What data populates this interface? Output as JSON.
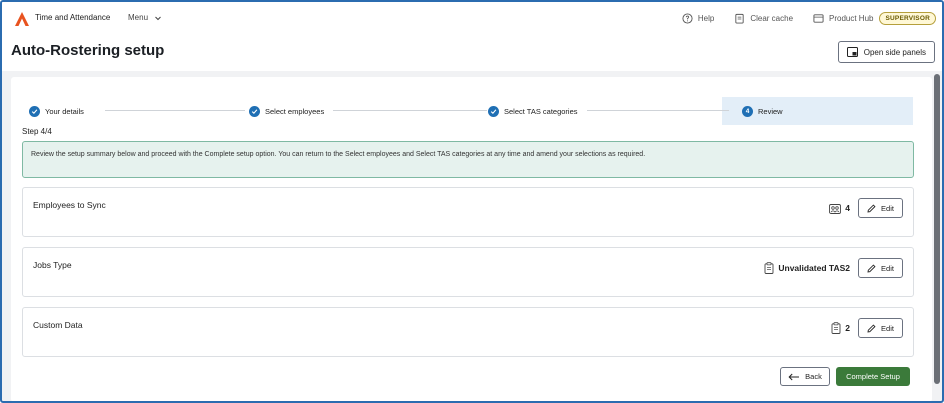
{
  "app": {
    "title": "Time and Attendance",
    "menu_label": "Menu"
  },
  "topbar": {
    "help_label": "Help",
    "clear_cache_label": "Clear cache",
    "product_hub_label": "Product Hub",
    "role_badge": "SUPERVISOR"
  },
  "page": {
    "title": "Auto-Rostering setup",
    "side_panels_label": "Open side panels"
  },
  "stepper": {
    "steps": [
      {
        "label": "Your details",
        "state": "complete"
      },
      {
        "label": "Select employees",
        "state": "complete"
      },
      {
        "label": "Select TAS categories",
        "state": "complete"
      },
      {
        "label": "Review",
        "state": "active",
        "number": "4"
      }
    ],
    "step_count": "Step 4/4"
  },
  "info_message": "Review the setup summary below and proceed with the Complete setup option. You can return to the Select employees and Select TAS categories at any time and amend your selections as required.",
  "sections": [
    {
      "title": "Employees to Sync",
      "value": "4",
      "icon": "employees-icon",
      "edit_label": "Edit"
    },
    {
      "title": "Jobs Type",
      "value": "Unvalidated TAS2",
      "icon": "clipboard-icon",
      "edit_label": "Edit"
    },
    {
      "title": "Custom Data",
      "value": "2",
      "icon": "clipboard-icon",
      "edit_label": "Edit"
    }
  ],
  "actions": {
    "back_label": "Back",
    "complete_label": "Complete Setup"
  },
  "colors": {
    "accent": "#1f6fb4",
    "primary_button": "#3b7a3a",
    "info_bg": "#e6f2ee",
    "logo": "#e8531f"
  }
}
